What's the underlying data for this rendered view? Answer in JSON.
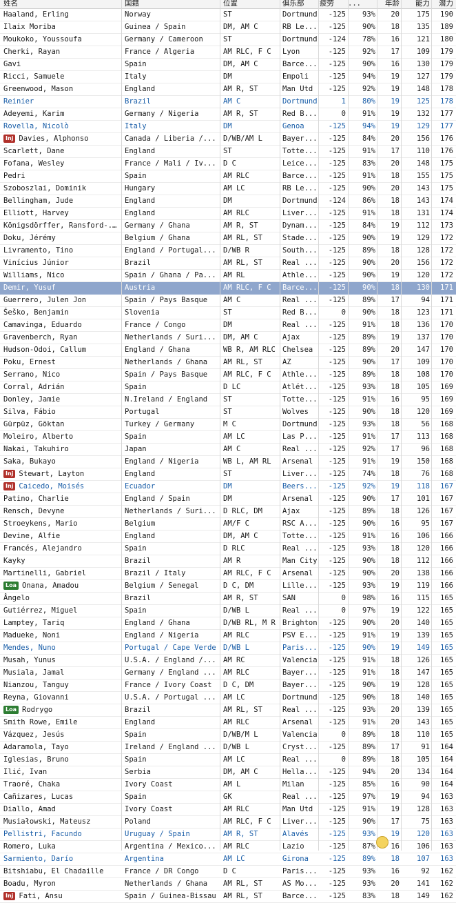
{
  "columns": [
    "姓名",
    "国籍",
    "位置",
    "俱乐部",
    "疲劳",
    "...",
    "年龄",
    "能力",
    "潜力"
  ],
  "rows": [
    {
      "name": "Haaland, Erling",
      "nat": "Norway",
      "pos": "ST",
      "club": "Dortmund",
      "fat": "-125",
      "cond": "93%",
      "age": "20",
      "ca": "175",
      "pa": "190"
    },
    {
      "name": "Ilaix Moriba",
      "nat": "Guinea / Spain",
      "pos": "DM, AM C",
      "club": "RB Le...",
      "fat": "-125",
      "cond": "90%",
      "age": "18",
      "ca": "135",
      "pa": "189"
    },
    {
      "name": "Moukoko, Youssoufa",
      "nat": "Germany / Cameroon",
      "pos": "ST",
      "club": "Dortmund",
      "fat": "-124",
      "cond": "78%",
      "age": "16",
      "ca": "121",
      "pa": "180"
    },
    {
      "name": "Cherki, Rayan",
      "nat": "France / Algeria",
      "pos": "AM RLC, F C",
      "club": "Lyon",
      "fat": "-125",
      "cond": "92%",
      "age": "17",
      "ca": "109",
      "pa": "179"
    },
    {
      "name": "Gavi",
      "nat": "Spain",
      "pos": "DM, AM C",
      "club": "Barce...",
      "fat": "-125",
      "cond": "90%",
      "age": "16",
      "ca": "130",
      "pa": "179"
    },
    {
      "name": "Ricci, Samuele",
      "nat": "Italy",
      "pos": "DM",
      "club": "Empoli",
      "fat": "-125",
      "cond": "94%",
      "age": "19",
      "ca": "127",
      "pa": "179"
    },
    {
      "name": "Greenwood, Mason",
      "nat": "England",
      "pos": "AM R, ST",
      "club": "Man Utd",
      "fat": "-125",
      "cond": "92%",
      "age": "19",
      "ca": "148",
      "pa": "178"
    },
    {
      "name": "Reinier",
      "nat": "Brazil",
      "pos": "AM C",
      "club": "Dortmund",
      "fat": "1",
      "cond": "80%",
      "age": "19",
      "ca": "125",
      "pa": "178",
      "style": "blue"
    },
    {
      "name": "Adeyemi, Karim",
      "nat": "Germany / Nigeria",
      "pos": "AM R, ST",
      "club": "Red B...",
      "fat": "0",
      "cond": "91%",
      "age": "19",
      "ca": "132",
      "pa": "177"
    },
    {
      "name": "Rovella, Nicolò",
      "nat": "Italy",
      "pos": "DM",
      "club": "Genoa",
      "fat": "-125",
      "cond": "94%",
      "age": "19",
      "ca": "129",
      "pa": "177",
      "style": "blue"
    },
    {
      "name": "Davies, Alphonso",
      "nat": "Canada / Liberia /...",
      "pos": "D/WB/AM L",
      "club": "Bayer...",
      "fat": "-125",
      "cond": "84%",
      "age": "20",
      "ca": "156",
      "pa": "176",
      "badge": "Inj"
    },
    {
      "name": "Scarlett, Dane",
      "nat": "England",
      "pos": "ST",
      "club": "Totte...",
      "fat": "-125",
      "cond": "91%",
      "age": "17",
      "ca": "110",
      "pa": "176"
    },
    {
      "name": "Fofana, Wesley",
      "nat": "France / Mali / Iv...",
      "pos": "D C",
      "club": "Leice...",
      "fat": "-125",
      "cond": "83%",
      "age": "20",
      "ca": "148",
      "pa": "175"
    },
    {
      "name": "Pedri",
      "nat": "Spain",
      "pos": "AM RLC",
      "club": "Barce...",
      "fat": "-125",
      "cond": "91%",
      "age": "18",
      "ca": "155",
      "pa": "175"
    },
    {
      "name": "Szoboszlai, Dominik",
      "nat": "Hungary",
      "pos": "AM LC",
      "club": "RB Le...",
      "fat": "-125",
      "cond": "90%",
      "age": "20",
      "ca": "143",
      "pa": "175"
    },
    {
      "name": "Bellingham, Jude",
      "nat": "England",
      "pos": "DM",
      "club": "Dortmund",
      "fat": "-124",
      "cond": "86%",
      "age": "18",
      "ca": "143",
      "pa": "174"
    },
    {
      "name": "Elliott, Harvey",
      "nat": "England",
      "pos": "AM RLC",
      "club": "Liver...",
      "fat": "-125",
      "cond": "91%",
      "age": "18",
      "ca": "131",
      "pa": "174"
    },
    {
      "name": "Königsdörffer, Ransford-...",
      "nat": "Germany / Ghana",
      "pos": "AM R, ST",
      "club": "Dynam...",
      "fat": "-125",
      "cond": "84%",
      "age": "19",
      "ca": "112",
      "pa": "173"
    },
    {
      "name": "Doku, Jérémy",
      "nat": "Belgium / Ghana",
      "pos": "AM RL, ST",
      "club": "Stade...",
      "fat": "-125",
      "cond": "90%",
      "age": "19",
      "ca": "129",
      "pa": "172"
    },
    {
      "name": "Livramento, Tino",
      "nat": "England / Portugal...",
      "pos": "D/WB R",
      "club": "South...",
      "fat": "-125",
      "cond": "89%",
      "age": "18",
      "ca": "128",
      "pa": "172"
    },
    {
      "name": "Vinícius Júnior",
      "nat": "Brazil",
      "pos": "AM RL, ST",
      "club": "Real ...",
      "fat": "-125",
      "cond": "90%",
      "age": "20",
      "ca": "156",
      "pa": "172"
    },
    {
      "name": "Williams, Nico",
      "nat": "Spain / Ghana / Pa...",
      "pos": "AM RL",
      "club": "Athle...",
      "fat": "-125",
      "cond": "90%",
      "age": "19",
      "ca": "120",
      "pa": "172"
    },
    {
      "name": "Demir, Yusuf",
      "nat": "Austria",
      "pos": "AM RLC, F C",
      "club": "Barce...",
      "fat": "-125",
      "cond": "90%",
      "age": "18",
      "ca": "130",
      "pa": "171",
      "style": "selected"
    },
    {
      "name": "Guerrero, Julen Jon",
      "nat": "Spain / Pays Basque",
      "pos": "AM C",
      "club": "Real ...",
      "fat": "-125",
      "cond": "89%",
      "age": "17",
      "ca": "94",
      "pa": "171"
    },
    {
      "name": "Šeško, Benjamin",
      "nat": "Slovenia",
      "pos": "ST",
      "club": "Red B...",
      "fat": "0",
      "cond": "90%",
      "age": "18",
      "ca": "123",
      "pa": "171"
    },
    {
      "name": "Camavinga, Eduardo",
      "nat": "France / Congo",
      "pos": "DM",
      "club": "Real ...",
      "fat": "-125",
      "cond": "91%",
      "age": "18",
      "ca": "136",
      "pa": "170"
    },
    {
      "name": "Gravenberch, Ryan",
      "nat": "Netherlands / Suri...",
      "pos": "DM, AM C",
      "club": "Ajax",
      "fat": "-125",
      "cond": "89%",
      "age": "19",
      "ca": "137",
      "pa": "170"
    },
    {
      "name": "Hudson-Odoi, Callum",
      "nat": "England / Ghana",
      "pos": "WB R, AM RLC",
      "club": "Chelsea",
      "fat": "-125",
      "cond": "89%",
      "age": "20",
      "ca": "147",
      "pa": "170"
    },
    {
      "name": "Poku, Ernest",
      "nat": "Netherlands / Ghana",
      "pos": "AM RL, ST",
      "club": "AZ",
      "fat": "-125",
      "cond": "90%",
      "age": "17",
      "ca": "109",
      "pa": "170"
    },
    {
      "name": "Serrano, Nico",
      "nat": "Spain / Pays Basque",
      "pos": "AM RLC, F C",
      "club": "Athle...",
      "fat": "-125",
      "cond": "89%",
      "age": "18",
      "ca": "108",
      "pa": "170"
    },
    {
      "name": "Corral, Adrián",
      "nat": "Spain",
      "pos": "D LC",
      "club": "Atlét...",
      "fat": "-125",
      "cond": "93%",
      "age": "18",
      "ca": "105",
      "pa": "169"
    },
    {
      "name": "Donley, Jamie",
      "nat": "N.Ireland / England",
      "pos": "ST",
      "club": "Totte...",
      "fat": "-125",
      "cond": "91%",
      "age": "16",
      "ca": "95",
      "pa": "169"
    },
    {
      "name": "Silva, Fábio",
      "nat": "Portugal",
      "pos": "ST",
      "club": "Wolves",
      "fat": "-125",
      "cond": "90%",
      "age": "18",
      "ca": "120",
      "pa": "169"
    },
    {
      "name": "Gürpüz, Göktan",
      "nat": "Turkey / Germany",
      "pos": "M C",
      "club": "Dortmund",
      "fat": "-125",
      "cond": "93%",
      "age": "18",
      "ca": "56",
      "pa": "168"
    },
    {
      "name": "Moleiro, Alberto",
      "nat": "Spain",
      "pos": "AM LC",
      "club": "Las P...",
      "fat": "-125",
      "cond": "91%",
      "age": "17",
      "ca": "113",
      "pa": "168"
    },
    {
      "name": "Nakai, Takuhiro",
      "nat": "Japan",
      "pos": "AM C",
      "club": "Real ...",
      "fat": "-125",
      "cond": "92%",
      "age": "17",
      "ca": "96",
      "pa": "168"
    },
    {
      "name": "Saka, Bukayo",
      "nat": "England / Nigeria",
      "pos": "WB L, AM RL",
      "club": "Arsenal",
      "fat": "-125",
      "cond": "91%",
      "age": "19",
      "ca": "150",
      "pa": "168"
    },
    {
      "name": "Stewart, Layton",
      "nat": "England",
      "pos": "ST",
      "club": "Liver...",
      "fat": "-125",
      "cond": "74%",
      "age": "18",
      "ca": "76",
      "pa": "168",
      "badge": "Inj"
    },
    {
      "name": "Caicedo, Moisés",
      "nat": "Ecuador",
      "pos": "DM",
      "club": "Beers...",
      "fat": "-125",
      "cond": "92%",
      "age": "19",
      "ca": "118",
      "pa": "167",
      "badge": "Inj",
      "style": "blue"
    },
    {
      "name": "Patino, Charlie",
      "nat": "England / Spain",
      "pos": "DM",
      "club": "Arsenal",
      "fat": "-125",
      "cond": "90%",
      "age": "17",
      "ca": "101",
      "pa": "167"
    },
    {
      "name": "Rensch, Devyne",
      "nat": "Netherlands / Suri...",
      "pos": "D RLC, DM",
      "club": "Ajax",
      "fat": "-125",
      "cond": "89%",
      "age": "18",
      "ca": "126",
      "pa": "167"
    },
    {
      "name": "Stroeykens, Mario",
      "nat": "Belgium",
      "pos": "AM/F C",
      "club": "RSC A...",
      "fat": "-125",
      "cond": "90%",
      "age": "16",
      "ca": "95",
      "pa": "167"
    },
    {
      "name": "Devine, Alfie",
      "nat": "England",
      "pos": "DM, AM C",
      "club": "Totte...",
      "fat": "-125",
      "cond": "91%",
      "age": "16",
      "ca": "106",
      "pa": "166"
    },
    {
      "name": "Francés, Alejandro",
      "nat": "Spain",
      "pos": "D RLC",
      "club": "Real ...",
      "fat": "-125",
      "cond": "93%",
      "age": "18",
      "ca": "120",
      "pa": "166"
    },
    {
      "name": "Kayky",
      "nat": "Brazil",
      "pos": "AM R",
      "club": "Man City",
      "fat": "-125",
      "cond": "90%",
      "age": "18",
      "ca": "112",
      "pa": "166"
    },
    {
      "name": "Martinelli, Gabriel",
      "nat": "Brazil / Italy",
      "pos": "AM RLC, F C",
      "club": "Arsenal",
      "fat": "-125",
      "cond": "90%",
      "age": "20",
      "ca": "138",
      "pa": "166"
    },
    {
      "name": "Onana, Amadou",
      "nat": "Belgium / Senegal",
      "pos": "D C, DM",
      "club": "Lille...",
      "fat": "-125",
      "cond": "93%",
      "age": "19",
      "ca": "119",
      "pa": "166",
      "badge": "Loa"
    },
    {
      "name": "Ângelo",
      "nat": "Brazil",
      "pos": "AM R, ST",
      "club": "SAN",
      "fat": "0",
      "cond": "98%",
      "age": "16",
      "ca": "115",
      "pa": "165"
    },
    {
      "name": "Gutiérrez, Miguel",
      "nat": "Spain",
      "pos": "D/WB L",
      "club": "Real ...",
      "fat": "0",
      "cond": "97%",
      "age": "19",
      "ca": "122",
      "pa": "165"
    },
    {
      "name": "Lamptey, Tariq",
      "nat": "England / Ghana",
      "pos": "D/WB RL, M R",
      "club": "Brighton",
      "fat": "-125",
      "cond": "90%",
      "age": "20",
      "ca": "140",
      "pa": "165"
    },
    {
      "name": "Madueke, Noni",
      "nat": "England / Nigeria",
      "pos": "AM RLC",
      "club": "PSV E...",
      "fat": "-125",
      "cond": "91%",
      "age": "19",
      "ca": "139",
      "pa": "165"
    },
    {
      "name": "Mendes, Nuno",
      "nat": "Portugal / Cape Verde",
      "pos": "D/WB L",
      "club": "Paris...",
      "fat": "-125",
      "cond": "90%",
      "age": "19",
      "ca": "149",
      "pa": "165",
      "style": "blue"
    },
    {
      "name": "Musah, Yunus",
      "nat": "U.S.A. / England /...",
      "pos": "AM RC",
      "club": "Valencia",
      "fat": "-125",
      "cond": "91%",
      "age": "18",
      "ca": "126",
      "pa": "165"
    },
    {
      "name": "Musiala, Jamal",
      "nat": "Germany / England ...",
      "pos": "AM RLC",
      "club": "Bayer...",
      "fat": "-125",
      "cond": "91%",
      "age": "18",
      "ca": "147",
      "pa": "165"
    },
    {
      "name": "Nianzou, Tanguy",
      "nat": "France / Ivory Coast",
      "pos": "D C, DM",
      "club": "Bayer...",
      "fat": "-125",
      "cond": "90%",
      "age": "19",
      "ca": "128",
      "pa": "165"
    },
    {
      "name": "Reyna, Giovanni",
      "nat": "U.S.A. / Portugal ...",
      "pos": "AM LC",
      "club": "Dortmund",
      "fat": "-125",
      "cond": "90%",
      "age": "18",
      "ca": "140",
      "pa": "165"
    },
    {
      "name": "Rodrygo",
      "nat": "Brazil",
      "pos": "AM RL, ST",
      "club": "Real ...",
      "fat": "-125",
      "cond": "93%",
      "age": "20",
      "ca": "139",
      "pa": "165",
      "badge": "Loa"
    },
    {
      "name": "Smith Rowe, Emile",
      "nat": "England",
      "pos": "AM RLC",
      "club": "Arsenal",
      "fat": "-125",
      "cond": "91%",
      "age": "20",
      "ca": "143",
      "pa": "165"
    },
    {
      "name": "Vázquez, Jesús",
      "nat": "Spain",
      "pos": "D/WB/M L",
      "club": "Valencia",
      "fat": "0",
      "cond": "89%",
      "age": "18",
      "ca": "110",
      "pa": "165"
    },
    {
      "name": "Adaramola, Tayo",
      "nat": "Ireland / England ...",
      "pos": "D/WB L",
      "club": "Cryst...",
      "fat": "-125",
      "cond": "89%",
      "age": "17",
      "ca": "91",
      "pa": "164"
    },
    {
      "name": "Iglesias, Bruno",
      "nat": "Spain",
      "pos": "AM LC",
      "club": "Real ...",
      "fat": "0",
      "cond": "89%",
      "age": "18",
      "ca": "105",
      "pa": "164"
    },
    {
      "name": "Ilić, Ivan",
      "nat": "Serbia",
      "pos": "DM, AM C",
      "club": "Hella...",
      "fat": "-125",
      "cond": "94%",
      "age": "20",
      "ca": "134",
      "pa": "164"
    },
    {
      "name": "Traoré, Chaka",
      "nat": "Ivory Coast",
      "pos": "AM L",
      "club": "Milan",
      "fat": "-125",
      "cond": "85%",
      "age": "16",
      "ca": "90",
      "pa": "164"
    },
    {
      "name": "Cañizares, Lucas",
      "nat": "Spain",
      "pos": "GK",
      "club": "Real ...",
      "fat": "-125",
      "cond": "97%",
      "age": "19",
      "ca": "94",
      "pa": "163"
    },
    {
      "name": "Diallo, Amad",
      "nat": "Ivory Coast",
      "pos": "AM RLC",
      "club": "Man Utd",
      "fat": "-125",
      "cond": "91%",
      "age": "19",
      "ca": "128",
      "pa": "163"
    },
    {
      "name": "Musiałowski, Mateusz",
      "nat": "Poland",
      "pos": "AM RLC, F C",
      "club": "Liver...",
      "fat": "-125",
      "cond": "90%",
      "age": "17",
      "ca": "75",
      "pa": "163"
    },
    {
      "name": "Pellistri, Facundo",
      "nat": "Uruguay / Spain",
      "pos": "AM R, ST",
      "club": "Alavés",
      "fat": "-125",
      "cond": "93%",
      "age": "19",
      "ca": "120",
      "pa": "163",
      "style": "blue"
    },
    {
      "name": "Romero, Luka",
      "nat": "Argentina / Mexico...",
      "pos": "AM RLC",
      "club": "Lazio",
      "fat": "-125",
      "cond": "87%",
      "age": "16",
      "ca": "106",
      "pa": "163"
    },
    {
      "name": "Sarmiento, Darío",
      "nat": "Argentina",
      "pos": "AM LC",
      "club": "Girona",
      "fat": "-125",
      "cond": "89%",
      "age": "18",
      "ca": "107",
      "pa": "163",
      "style": "blue"
    },
    {
      "name": "Bitshiabu, El Chadaille",
      "nat": "France / DR Congo",
      "pos": "D C",
      "club": "Paris...",
      "fat": "-125",
      "cond": "93%",
      "age": "16",
      "ca": "92",
      "pa": "162"
    },
    {
      "name": "Boadu, Myron",
      "nat": "Netherlands / Ghana",
      "pos": "AM RL, ST",
      "club": "AS Mo...",
      "fat": "-125",
      "cond": "93%",
      "age": "20",
      "ca": "141",
      "pa": "162"
    },
    {
      "name": "Fati, Ansu",
      "nat": "Spain / Guinea-Bissau",
      "pos": "AM RL, ST",
      "club": "Barce...",
      "fat": "-125",
      "cond": "83%",
      "age": "18",
      "ca": "149",
      "pa": "162",
      "badge": "Inj"
    }
  ]
}
